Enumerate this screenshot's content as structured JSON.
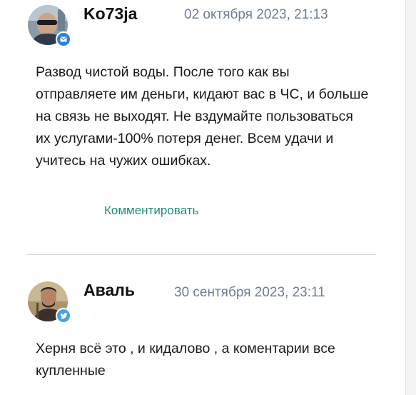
{
  "comments": [
    {
      "author": "Ko73ja",
      "date": "02 октября 2023, 21:13",
      "badge_icon": "email-icon",
      "badge_color": "#2f7fd8",
      "text": "Развод чистой воды. После того как вы отправляете им деньги, кидают вас в ЧС, и больше на связь не выходят. Не вздумайте пользоваться их услугами-100% потеря денег. Всем удачи и учитесь на чужих ошибках.",
      "reply_label": "Комментировать"
    },
    {
      "author": "Аваль",
      "date": "30 сентября 2023, 23:11",
      "badge_icon": "twitter-bird-icon",
      "badge_color": "#4aa3df",
      "text": "Херня всё это , и кидалово , а коментарии все купленные"
    }
  ],
  "colors": {
    "date": "#6e7f91",
    "link": "#1d8f7a",
    "divider": "#d4d4d4"
  }
}
